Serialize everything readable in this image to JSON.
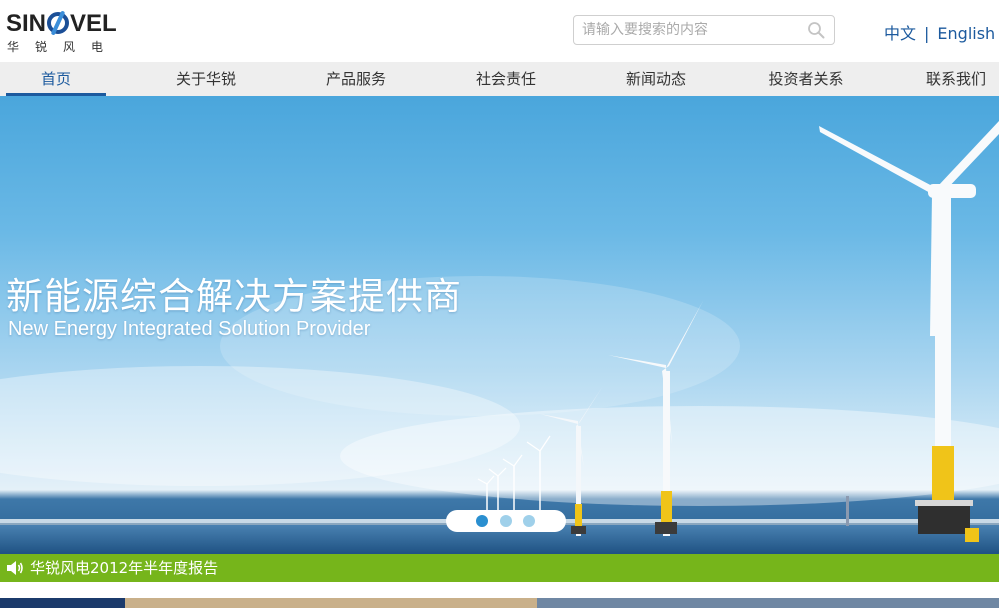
{
  "header": {
    "logo": {
      "word": "SINOVEL",
      "cn": "华锐风电"
    },
    "search": {
      "placeholder": "请输入要搜索的内容"
    },
    "lang": {
      "cn": "中文",
      "sep": "|",
      "en": "English"
    }
  },
  "nav": {
    "items": [
      "首页",
      "关于华锐",
      "产品服务",
      "社会责任",
      "新闻动态",
      "投资者关系",
      "联系我们"
    ],
    "active_index": 0
  },
  "banner": {
    "title_cn": "新能源综合解决方案提供商",
    "title_en": "New Energy Integrated Solution Provider",
    "slides": 3,
    "active_slide": 0
  },
  "notice": {
    "text": "华锐风电2012年半年度报告"
  },
  "icons": {
    "search": "search-icon",
    "speaker": "speaker-icon"
  },
  "colors": {
    "brand_blue": "#1c5a9e",
    "notice_green": "#76b51b",
    "nav_bg": "#eeeeee"
  }
}
